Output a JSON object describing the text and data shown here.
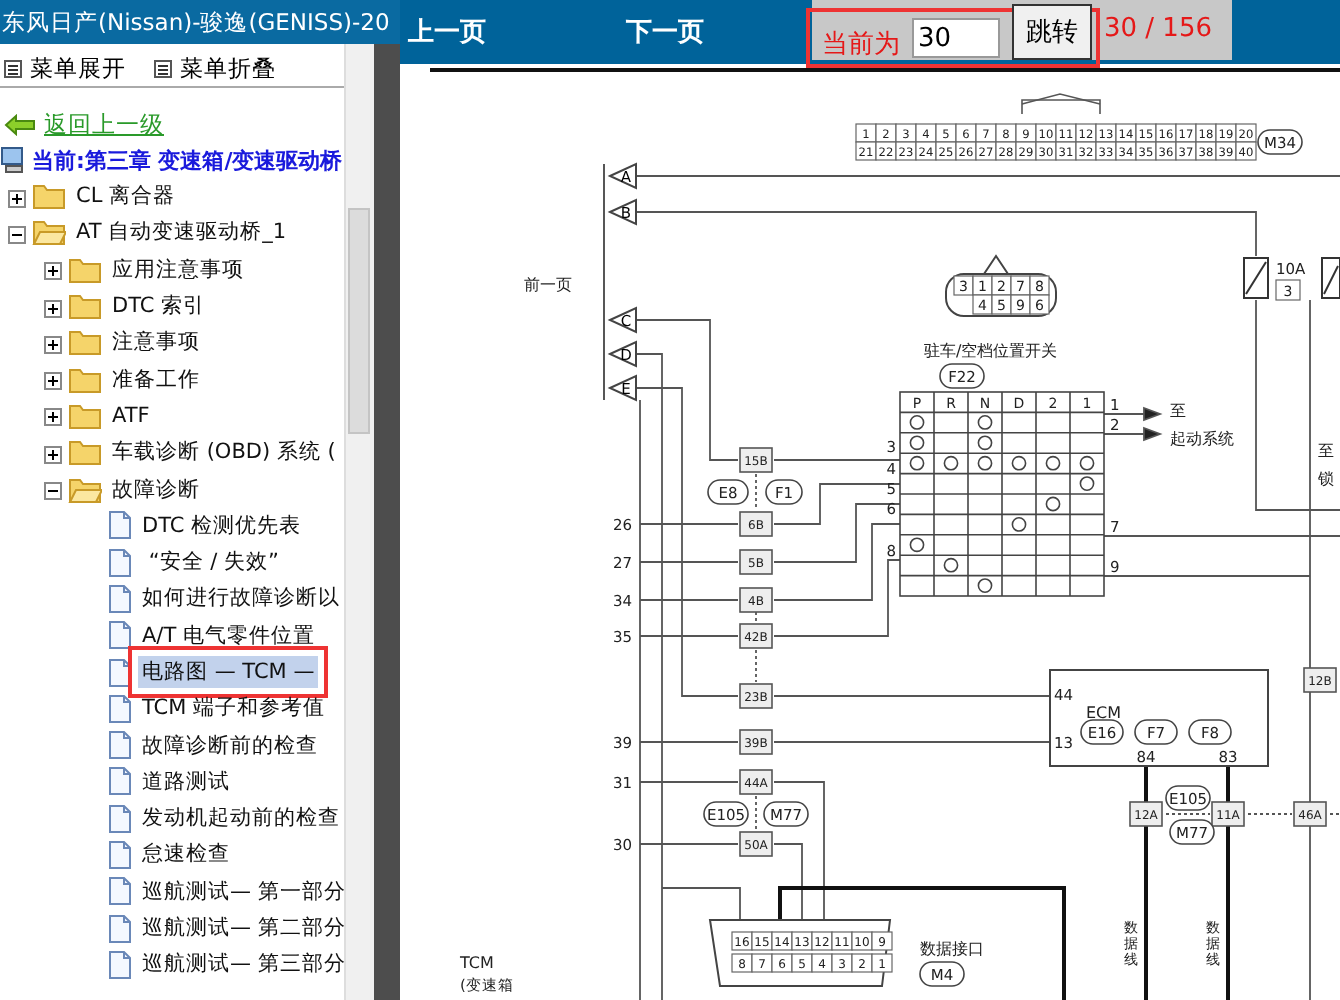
{
  "sidebar": {
    "title": "东风日产(Nissan)-骏逸(GENISS)-20",
    "toolbar": [
      {
        "label": "菜单展开"
      },
      {
        "label": "菜单折叠"
      }
    ],
    "back_link": "返回上一级",
    "current_location": "当前:第三章 变速箱/变速驱动桥",
    "tree": [
      {
        "kind": "folder",
        "label": "CL 离合器",
        "expanded": false,
        "selected": false
      },
      {
        "kind": "folder",
        "label": "AT 自动变速驱动桥_1",
        "expanded": true,
        "selected": false,
        "children": [
          {
            "kind": "folder",
            "label": "应用注意事项",
            "expanded": false,
            "selected": false
          },
          {
            "kind": "folder",
            "label": "DTC 索引",
            "expanded": false,
            "selected": false
          },
          {
            "kind": "folder",
            "label": "注意事项",
            "expanded": false,
            "selected": false
          },
          {
            "kind": "folder",
            "label": "准备工作",
            "expanded": false,
            "selected": false
          },
          {
            "kind": "folder",
            "label": "ATF",
            "expanded": false,
            "selected": false
          },
          {
            "kind": "folder",
            "label": "车载诊断 (OBD) 系统 (",
            "expanded": false,
            "selected": false
          },
          {
            "kind": "folder",
            "label": "故障诊断",
            "expanded": true,
            "selected": false,
            "children": [
              {
                "kind": "page",
                "label": "DTC 检测优先表",
                "selected": false
              },
              {
                "kind": "page",
                "label": " “安全 / 失效”",
                "selected": false
              },
              {
                "kind": "page",
                "label": "如何进行故障诊断以",
                "selected": false
              },
              {
                "kind": "page",
                "label": "A/T 电气零件位置",
                "selected": false
              },
              {
                "kind": "page",
                "label": "电路图 — TCM —",
                "selected": true
              },
              {
                "kind": "page",
                "label": "TCM 端子和参考值",
                "selected": false
              },
              {
                "kind": "page",
                "label": "故障诊断前的检查",
                "selected": false
              },
              {
                "kind": "page",
                "label": "道路测试",
                "selected": false
              },
              {
                "kind": "page",
                "label": "发动机起动前的检查",
                "selected": false
              },
              {
                "kind": "page",
                "label": "怠速检查",
                "selected": false
              },
              {
                "kind": "page",
                "label": "巡航测试— 第一部分",
                "selected": false
              },
              {
                "kind": "page",
                "label": "巡航测试— 第二部分",
                "selected": false
              },
              {
                "kind": "page",
                "label": "巡航测试— 第三部分",
                "selected": false
              }
            ]
          }
        ]
      }
    ]
  },
  "nav_bar": {
    "prev_page": "上一页",
    "next_page": "下一页",
    "current_label": "当前为",
    "page_input": "30",
    "go_button": "跳转",
    "page_count": "30 / 156"
  },
  "diagram": {
    "page_ref": "前一页",
    "link_markers": [
      "A",
      "B",
      "C",
      "D",
      "E"
    ],
    "main_connector": {
      "id": "M34",
      "row_1": [
        "1",
        "2",
        "3",
        "4",
        "5",
        "6",
        "7",
        "8",
        "9",
        "10",
        "11",
        "12",
        "13",
        "14",
        "15",
        "16",
        "17",
        "18",
        "19",
        "20"
      ],
      "row_2": [
        "21",
        "22",
        "23",
        "24",
        "25",
        "26",
        "27",
        "28",
        "29",
        "30",
        "31",
        "32",
        "33",
        "34",
        "35",
        "36",
        "37",
        "38",
        "39",
        "40"
      ]
    },
    "fuse": {
      "rating": "10A",
      "number": "3"
    },
    "switch_plug": {
      "row_1": [
        "3",
        "1",
        "2",
        "7",
        "8"
      ],
      "row_2": [
        "4",
        "5",
        "9",
        "6"
      ]
    },
    "switch": {
      "title": "驻车/空档位置开关",
      "connector": "F22",
      "positions": [
        "P",
        "R",
        "N",
        "D",
        "2",
        "1"
      ],
      "input_pins": [
        "3",
        "4",
        "5",
        "6",
        "8"
      ],
      "output_pins": [
        "1",
        "2",
        "7",
        "9"
      ],
      "output_note": [
        "至",
        "起动系统"
      ]
    },
    "side_note": [
      "至",
      "锁"
    ],
    "tcm_pins": [
      "26",
      "27",
      "34",
      "35",
      "39",
      "31",
      "30"
    ],
    "joint_pins": [
      "15B",
      "6B",
      "5B",
      "4B",
      "42B",
      "23B",
      "39B",
      "44A",
      "50A"
    ],
    "joint_connectors_upper": [
      "E8",
      "F1"
    ],
    "joint_connectors_lower": [
      "E105",
      "M77"
    ],
    "ecm": {
      "title": "ECM",
      "connectors": [
        "E16",
        "F7",
        "F8"
      ],
      "input_pins": [
        "44",
        "13"
      ],
      "output_pins": [
        "84",
        "83"
      ]
    },
    "ecm_joint_pins": [
      "12A",
      "11A",
      "46A"
    ],
    "ecm_joint_connectors": [
      "E105",
      "M77"
    ],
    "right_joint_pin": "12B",
    "data_link": {
      "title": "数据接口",
      "connector": "M4",
      "row_1": [
        "16",
        "15",
        "14",
        "13",
        "12",
        "11",
        "10",
        "9"
      ],
      "row_2": [
        "8",
        "7",
        "6",
        "5",
        "4",
        "3",
        "2",
        "1"
      ]
    },
    "wire_labels": [
      "数据线",
      "数据线"
    ],
    "tcm": {
      "title": "TCM",
      "subtitle": "(变速箱"
    }
  }
}
